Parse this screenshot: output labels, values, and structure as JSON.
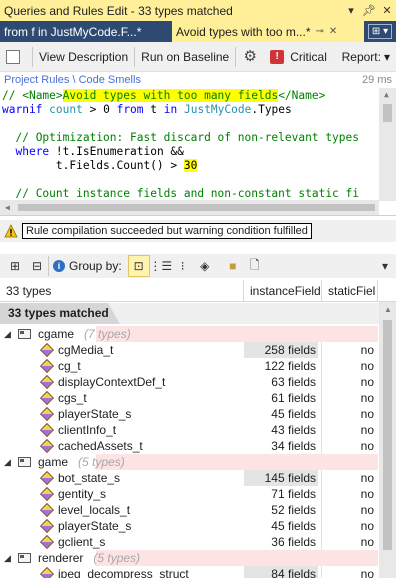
{
  "window": {
    "title": "Queries and Rules Edit  - 33 types matched",
    "pin_icon": "pin-icon",
    "close_icon": "close-icon"
  },
  "tabs": [
    {
      "label": "from f in JustMyCode.F...*",
      "active": false
    },
    {
      "label": "Avoid types with too m...*",
      "active": true
    }
  ],
  "tab_dropdown_label": "▾",
  "toolbar": {
    "view_description": "View Description",
    "run_on_baseline": "Run on Baseline",
    "critical": "Critical",
    "report": "Report:"
  },
  "breadcrumb": {
    "path": "Project Rules \\ Code Smells",
    "elapsed": "29 ms"
  },
  "code": {
    "line1_prefix": "// ",
    "line1_tag_open": "<Name>",
    "line1_title": "Avoid types with too many fields",
    "line1_tag_close": "</Name>",
    "line2_kw1": "warnif",
    "line2_count": "count",
    "line2_op": " > ",
    "line2_zero": "0",
    "line2_from": "from",
    "line2_t": " t ",
    "line2_in": "in",
    "line2_src": "JustMyCode",
    "line2_types": ".Types",
    "line4_comment": "// Optimization: Fast discard of non-relevant types",
    "line5_where": "where",
    "line5_rest": " !t.IsEnumeration &&",
    "line6_rest": "t.Fields.Count() > ",
    "line6_num": "30",
    "line8_comment": "// Count instance fields and non-constant static fi"
  },
  "status": {
    "icon": "warning-icon",
    "message": "Rule compilation succeeded but warning condition fulfilled"
  },
  "results_toolbar": {
    "group_by_label": "Group by:"
  },
  "grid": {
    "columns": [
      "33 types",
      "instanceField",
      "staticFiel"
    ],
    "matched_label": "33 types matched",
    "groups": [
      {
        "name": "cgame",
        "count": "(7 types)",
        "rows": [
          {
            "name": "cgMedia_t",
            "fields": "258 fields",
            "static": "no"
          },
          {
            "name": "cg_t",
            "fields": "122 fields",
            "static": "no"
          },
          {
            "name": "displayContextDef_t",
            "fields": "63 fields",
            "static": "no"
          },
          {
            "name": "cgs_t",
            "fields": "61 fields",
            "static": "no"
          },
          {
            "name": "playerState_s",
            "fields": "45 fields",
            "static": "no"
          },
          {
            "name": "clientInfo_t",
            "fields": "43 fields",
            "static": "no"
          },
          {
            "name": "cachedAssets_t",
            "fields": "34 fields",
            "static": "no"
          }
        ]
      },
      {
        "name": "game",
        "count": "(5 types)",
        "rows": [
          {
            "name": "bot_state_s",
            "fields": "145 fields",
            "static": "no"
          },
          {
            "name": "gentity_s",
            "fields": "71 fields",
            "static": "no"
          },
          {
            "name": "level_locals_t",
            "fields": "52 fields",
            "static": "no"
          },
          {
            "name": "playerState_s",
            "fields": "45 fields",
            "static": "no"
          },
          {
            "name": "gclient_s",
            "fields": "36 fields",
            "static": "no"
          }
        ]
      },
      {
        "name": "renderer",
        "count": "(5 types)",
        "rows": [
          {
            "name": "jpeg_decompress_struct",
            "fields": "84 fields",
            "static": "no"
          }
        ]
      }
    ]
  },
  "colors": {
    "title_bar": "#ffef99",
    "tab_strip": "#2f4a72",
    "group_band": "#fde3e3",
    "highlight": "#ffff00",
    "link": "#4a6fd8"
  }
}
